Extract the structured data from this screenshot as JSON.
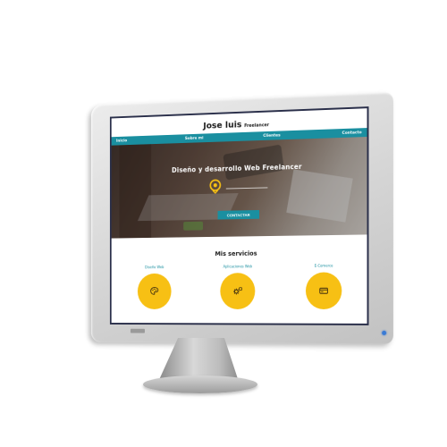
{
  "site": {
    "title": "Jose luis",
    "subtitle": "Freelancer",
    "nav": [
      "Inicio",
      "Sobre mi",
      "Clientes",
      "Contacto"
    ],
    "hero": {
      "title": "Diseño y desarrollo Web Freelancer",
      "button": "CONTACTAR"
    },
    "services": {
      "title": "Mis servicios",
      "items": [
        {
          "label": "Diseño Web",
          "icon": "palette-icon"
        },
        {
          "label": "Aplicaciones Web",
          "icon": "gear-icon"
        },
        {
          "label": "E-Comerce",
          "icon": "card-icon"
        }
      ]
    }
  },
  "colors": {
    "accent": "#1a8fa0",
    "highlight": "#f7c014",
    "bezel": "#d4d4d4"
  }
}
